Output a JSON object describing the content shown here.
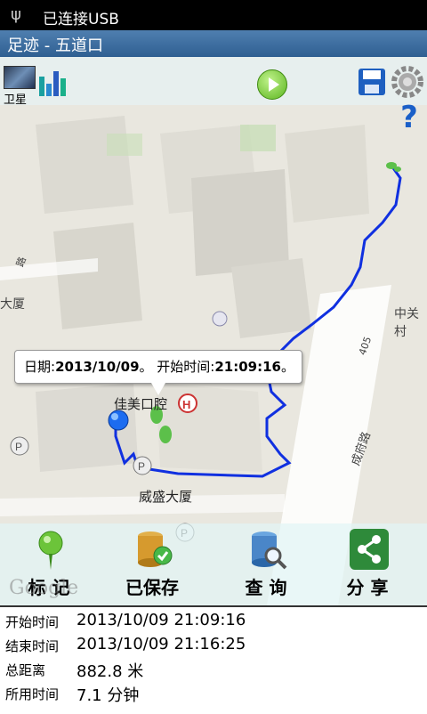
{
  "status": {
    "usb_icon": "usb-icon",
    "text": "已连接USB"
  },
  "title": "足迹 - 五道口",
  "toolbar": {
    "satellite_label": "卫星"
  },
  "map": {
    "labels": {
      "dasha": "大厦",
      "zhongguan": "中关村",
      "jiamei": "佳美口腔",
      "weisheng": "威盛大厦",
      "chengfu": "成府路",
      "road405": "405",
      "road_left": "路"
    }
  },
  "callout": {
    "date_label": "日期:",
    "date_value": "2013/10/09",
    "sep": "。 ",
    "start_label": "开始时间:",
    "start_value": "21:09:16",
    "end": "。"
  },
  "actions": [
    {
      "label": "标 记",
      "icon": "marker-pin-icon"
    },
    {
      "label": "已保存",
      "icon": "database-saved-icon"
    },
    {
      "label": "查 询",
      "icon": "database-search-icon"
    },
    {
      "label": "分 享",
      "icon": "share-icon"
    }
  ],
  "google": "Google",
  "info": [
    {
      "key": "开始时间",
      "value": "2013/10/09 21:09:16"
    },
    {
      "key": "结束时间",
      "value": "2013/10/09 21:16:25"
    },
    {
      "key": "总距离",
      "value": "882.8 米"
    },
    {
      "key": "所用时间",
      "value": "7.1 分钟"
    }
  ],
  "colors": {
    "track": "#1030e0",
    "title_bar": "#3a6a9c",
    "accent_green": "#5cb51f",
    "help": "#1a5fc8"
  }
}
